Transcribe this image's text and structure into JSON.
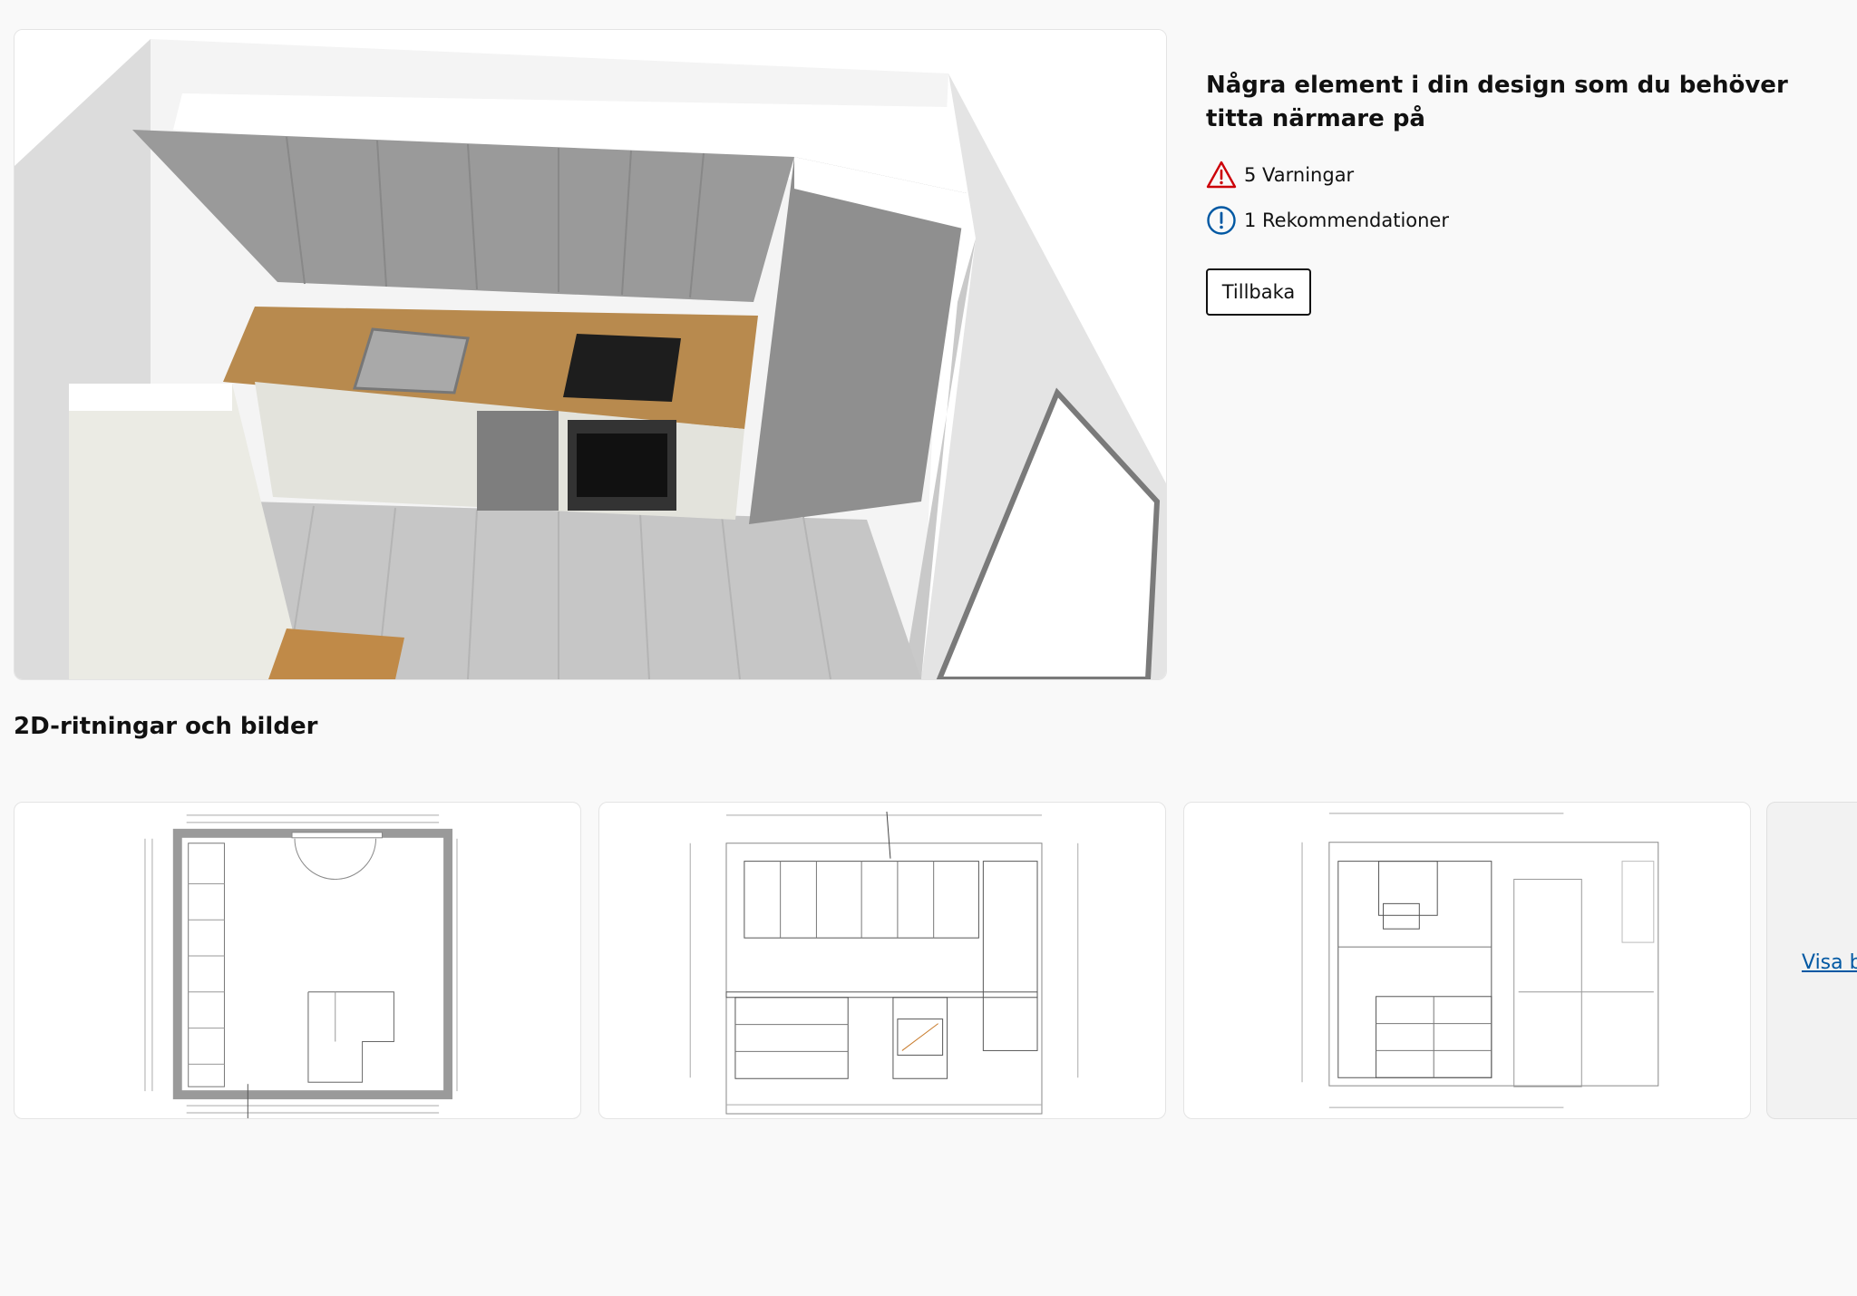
{
  "review": {
    "heading": "Några element i din design som du behöver titta närmare på",
    "warnings": {
      "label": "5 Varningar",
      "icon": "warning-triangle-icon",
      "color": "#cc0008"
    },
    "recommendations": {
      "label": "1 Rekommendationer",
      "icon": "info-circle-icon",
      "color": "#0058a3"
    },
    "back_button": "Tillbaka"
  },
  "drawings": {
    "title": "2D-ritningar och bilder",
    "items": [
      {
        "name": "floor-plan"
      },
      {
        "name": "elevation-front"
      },
      {
        "name": "elevation-side"
      }
    ],
    "show_more": "Visa b"
  }
}
